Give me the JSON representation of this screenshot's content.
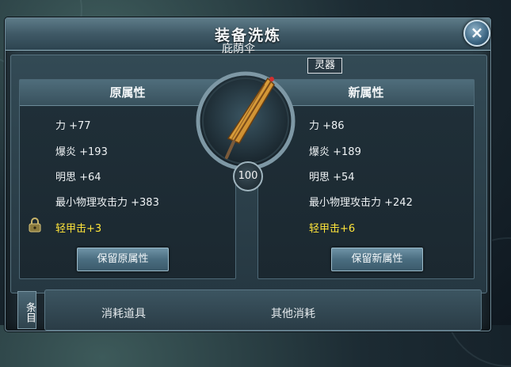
{
  "window": {
    "title": "装备洗炼",
    "close_label": "×"
  },
  "item": {
    "name": "庇荫伞",
    "badge": "灵器",
    "level": "100"
  },
  "original_panel": {
    "header": "原属性",
    "stats": [
      {
        "label": "力 +77"
      },
      {
        "label": "爆炎 +193"
      },
      {
        "label": "明思 +64"
      },
      {
        "label": "最小物理攻击力 +383"
      },
      {
        "label": "轻甲击+3"
      }
    ],
    "button": "保留原属性"
  },
  "new_panel": {
    "header": "新属性",
    "stats": [
      {
        "label": "力 +86"
      },
      {
        "label": "爆炎 +189"
      },
      {
        "label": "明思 +54"
      },
      {
        "label": "最小物理攻击力 +242"
      },
      {
        "label": "轻甲击+6"
      }
    ],
    "button": "保留新属性"
  },
  "bottom": {
    "side_tab": "条目",
    "consumables_label": "消耗道具",
    "other_costs_label": "其他消耗"
  },
  "colors": {
    "special_stat": "#ffe53a",
    "accent": "#6f93a6"
  }
}
